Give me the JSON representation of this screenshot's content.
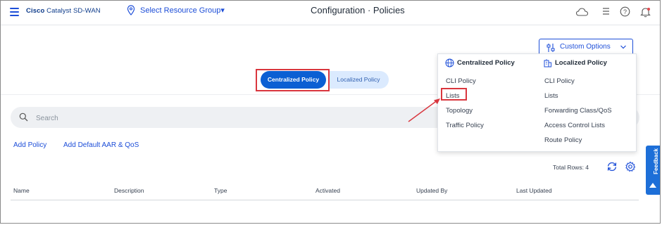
{
  "header": {
    "brand_bold": "Cisco",
    "brand_rest": "Catalyst SD-WAN",
    "resource_group": "Select Resource Group▾",
    "title": "Configuration · Policies",
    "icons": [
      "cloud-icon",
      "list-icon",
      "help-icon",
      "bell-icon"
    ]
  },
  "tabs": {
    "centralized": "Centralized Policy",
    "localized": "Localized Policy"
  },
  "search": {
    "placeholder": "Search"
  },
  "actions": {
    "add_policy": "Add Policy",
    "add_default": "Add Default AAR & QoS"
  },
  "table": {
    "total_rows": "Total Rows: 4",
    "columns": [
      "Name",
      "Description",
      "Type",
      "Activated",
      "Updated By",
      "Last Updated"
    ]
  },
  "custom_options": {
    "label": "Custom Options",
    "centralized_heading": "Centralized Policy",
    "localized_heading": "Localized Policy",
    "centralized_items": [
      "CLI Policy",
      "Lists",
      "Topology",
      "Traffic Policy"
    ],
    "localized_items": [
      "CLI Policy",
      "Lists",
      "Forwarding Class/QoS",
      "Access Control Lists",
      "Route Policy"
    ]
  },
  "feedback": "Feedback",
  "colors": {
    "accent": "#0b5fd3",
    "highlight": "#d9363e",
    "text": "#1f2a37"
  }
}
